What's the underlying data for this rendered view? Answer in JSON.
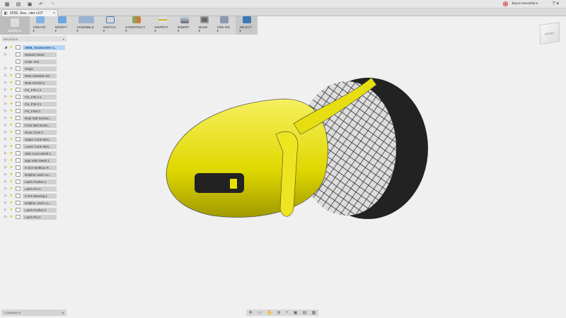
{
  "topbar": {
    "user": "Bryce Heventhal ▾",
    "help": "? ▾"
  },
  "tab": {
    "title": "Z506, Sea...oter v13*",
    "close": "×"
  },
  "toolbar": {
    "items": [
      "MODEL ▾",
      "CREATE ▾",
      "MODIFY ▾",
      "ASSEMBLE ▾",
      "SKETCH ▾",
      "CONSTRUCT ▾",
      "INSPECT ▾",
      "INSERT ▾",
      "MAKE ▾",
      "ADD-INS ▾",
      "SELECT ▾"
    ]
  },
  "browser": {
    "title": "BROWSER",
    "root": "Z506, SeaScooter v...",
    "items": [
      "Named Views",
      "Units: mm",
      "Origin",
      "Rear Gearbox Sh...",
      "Rear Nozzle:1",
      "Fin_FIN 1:1",
      "Fin_FIN 2:1",
      "Fin_FIN 3:1",
      "Fin_FIN4:1",
      "Rear Mid Section...",
      "Front Mid Sectio...",
      "Nose Cone:1",
      "Upper Cone Mes...",
      "Lower Cone Mes...",
      "Side Cone Mesh:1",
      "Opp Side Mesh:1",
      "9 inch Wolfson P...",
      "Dolphin Latch Le...",
      "Latch Pusher:1",
      "Latch Pin:1",
      "6 mm Bearing:1",
      "Dolphin Latch Le...",
      "Latch Pusher:2",
      "Latch Pin:2"
    ]
  },
  "viewcube": {
    "label": "FRONT"
  },
  "comments": {
    "title": "COMMENTS"
  },
  "colors": {
    "accent": "#4a8fd6",
    "body": "#e8e000"
  }
}
